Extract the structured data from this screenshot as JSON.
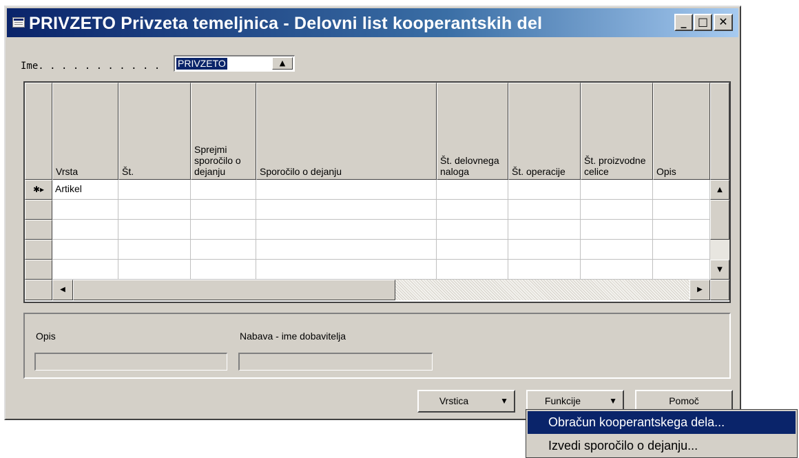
{
  "window": {
    "title": "PRIVZETO Privzeta temeljnica - Delovni list kooperantskih del",
    "min_icon": "minimize-icon",
    "max_icon": "maximize-icon",
    "close_icon": "close-icon"
  },
  "ime": {
    "label": "Ime. . . . . . . . . . .",
    "value": "PRIVZETO",
    "lookup_icon": "arrow-up-icon"
  },
  "grid": {
    "columns": [
      "Vrsta",
      "Št.",
      "Sprejmi sporočilo o dejanju",
      "Sporočilo o dejanju",
      "Št. delovnega naloga",
      "Št. operacije",
      "Št. proizvodne celice",
      "Opis"
    ],
    "rows": [
      [
        "Artikel",
        "",
        "",
        "",
        "",
        "",
        "",
        ""
      ],
      [
        "",
        "",
        "",
        "",
        "",
        "",
        "",
        ""
      ],
      [
        "",
        "",
        "",
        "",
        "",
        "",
        "",
        ""
      ],
      [
        "",
        "",
        "",
        "",
        "",
        "",
        "",
        ""
      ],
      [
        "",
        "",
        "",
        "",
        "",
        "",
        "",
        ""
      ]
    ],
    "new_row_marker": "✱▸"
  },
  "fields": {
    "opis_label": "Opis",
    "opis_value": "",
    "dobavitelj_label": "Nabava - ime dobavitelja",
    "dobavitelj_value": ""
  },
  "buttons": {
    "vrstica": "Vrstica",
    "funkcije": "Funkcije",
    "pomoc": "Pomoč"
  },
  "menu": {
    "items": [
      "Obračun kooperantskega dela...",
      "Izvedi sporočilo o dejanju..."
    ],
    "selected_index": 0
  }
}
